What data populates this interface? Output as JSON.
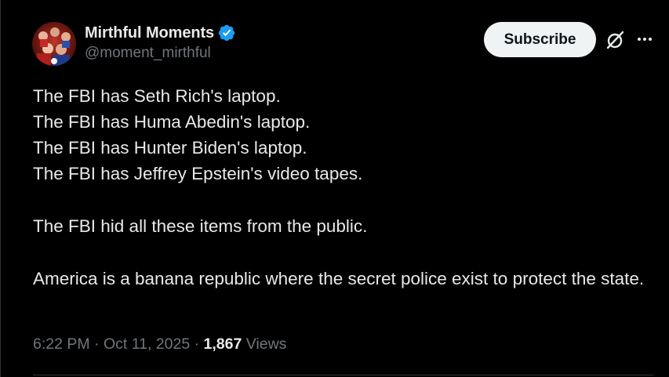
{
  "author": {
    "display_name": "Mirthful Moments",
    "handle": "@moment_mirthful",
    "verified": true
  },
  "actions": {
    "subscribe_label": "Subscribe",
    "grok_icon": "grok-icon",
    "more_icon": "more-icon"
  },
  "tweet": {
    "lines": [
      "The FBI has Seth Rich's laptop.",
      "The FBI has Huma Abedin's laptop.",
      "The FBI has Hunter Biden's laptop.",
      "The FBI has Jeffrey Epstein's video tapes.",
      "The FBI hid all these items from the public.",
      "America is a banana republic where the secret police exist to protect the state."
    ]
  },
  "meta": {
    "time": "6:22 PM",
    "separator": " · ",
    "date": "Oct 11, 2025",
    "views_count": "1,867",
    "views_label": " Views"
  },
  "colors": {
    "background": "#000000",
    "text_primary": "#e7e9ea",
    "text_secondary": "#71767b",
    "verified_blue": "#1d9bf0",
    "button_bg": "#eff3f4"
  }
}
